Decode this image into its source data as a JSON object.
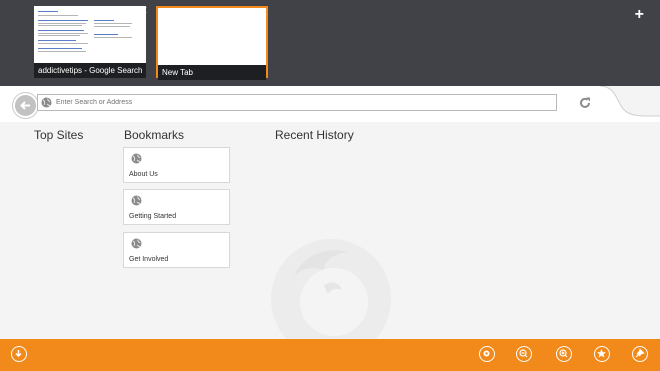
{
  "tabs": [
    {
      "title": "addictivetips - Google Search",
      "selected": false
    },
    {
      "title": "New Tab",
      "selected": true
    }
  ],
  "address_bar": {
    "placeholder": "Enter Search or Address",
    "value": ""
  },
  "sections": {
    "top_sites": "Top Sites",
    "bookmarks": "Bookmarks",
    "recent_history": "Recent History"
  },
  "bookmarks": [
    {
      "label": "About Us",
      "icon": "globe-icon"
    },
    {
      "label": "Getting Started",
      "icon": "globe-icon"
    },
    {
      "label": "Get Involved",
      "icon": "globe-icon"
    }
  ],
  "appbar": {
    "left": [
      "download-icon"
    ],
    "right": [
      "settings-icon",
      "zoom-out-icon",
      "zoom-in-icon",
      "star-icon",
      "pin-icon"
    ]
  },
  "colors": {
    "accent": "#f28a1b",
    "tabstrip": "#404247",
    "background": "#f4f4f4"
  }
}
